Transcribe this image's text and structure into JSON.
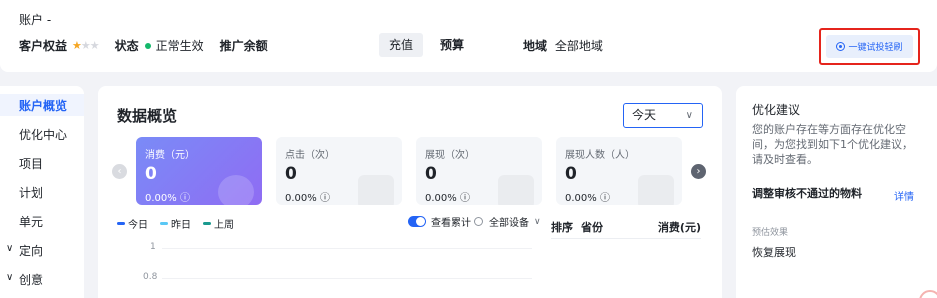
{
  "header": {
    "account_title": "账户 -",
    "rights_label": "客户权益",
    "stars": {
      "filled": 1,
      "total": 3
    },
    "status_label": "状态",
    "status_value": "正常生效",
    "promo_balance_label": "推广余额",
    "tabs": [
      {
        "label": "充值",
        "selected": true
      },
      {
        "label": "预算",
        "selected": false
      }
    ],
    "region_label": "地域",
    "region_value": "全部地域",
    "one_click_button": "一键试投轻刷"
  },
  "sidebar": {
    "items": [
      {
        "label": "账户概览",
        "active": true,
        "expandable": false
      },
      {
        "label": "优化中心",
        "active": false,
        "expandable": false
      },
      {
        "label": "项目",
        "active": false,
        "expandable": false
      },
      {
        "label": "计划",
        "active": false,
        "expandable": false
      },
      {
        "label": "单元",
        "active": false,
        "expandable": false
      },
      {
        "label": "定向",
        "active": false,
        "expandable": true
      },
      {
        "label": "创意",
        "active": false,
        "expandable": true
      }
    ]
  },
  "overview": {
    "title": "数据概览",
    "date_range": "今天",
    "cards": [
      {
        "title": "消费（元）",
        "value": "0",
        "change": "0.00%"
      },
      {
        "title": "点击（次）",
        "value": "0",
        "change": "0.00%"
      },
      {
        "title": "展现（次）",
        "value": "0",
        "change": "0.00%"
      },
      {
        "title": "展现人数（人）",
        "value": "0",
        "change": "0.00%"
      }
    ],
    "legend": [
      {
        "label": "今日",
        "color": "#2464f5"
      },
      {
        "label": "昨日",
        "color": "#5ac8f5"
      },
      {
        "label": "上周",
        "color": "#1a9a8f"
      }
    ],
    "cumulative_toggle_label": "查看累计",
    "device_select": "全部设备",
    "y_ticks": [
      "1",
      "0.8"
    ],
    "table_headers": {
      "rank": "排序",
      "province": "省份",
      "cost": "消费(元)"
    }
  },
  "suggestions": {
    "title": "优化建议",
    "description": "您的账户存在等方面存在优化空间，为您找到如下1个优化建议，请及时查看。",
    "item_title": "调整审核不通过的物料",
    "detail_link": "详情",
    "effect_label": "预估效果",
    "effect_value": "恢复展现"
  },
  "colors": {
    "accent": "#2464f5",
    "highlight_border": "#e5241c",
    "status_ok": "#14b86b"
  },
  "icons": {
    "prev": "chevron-left-icon",
    "next": "chevron-right-icon",
    "info": "info-icon",
    "dropdown": "chevron-down-icon",
    "star": "star-icon"
  }
}
